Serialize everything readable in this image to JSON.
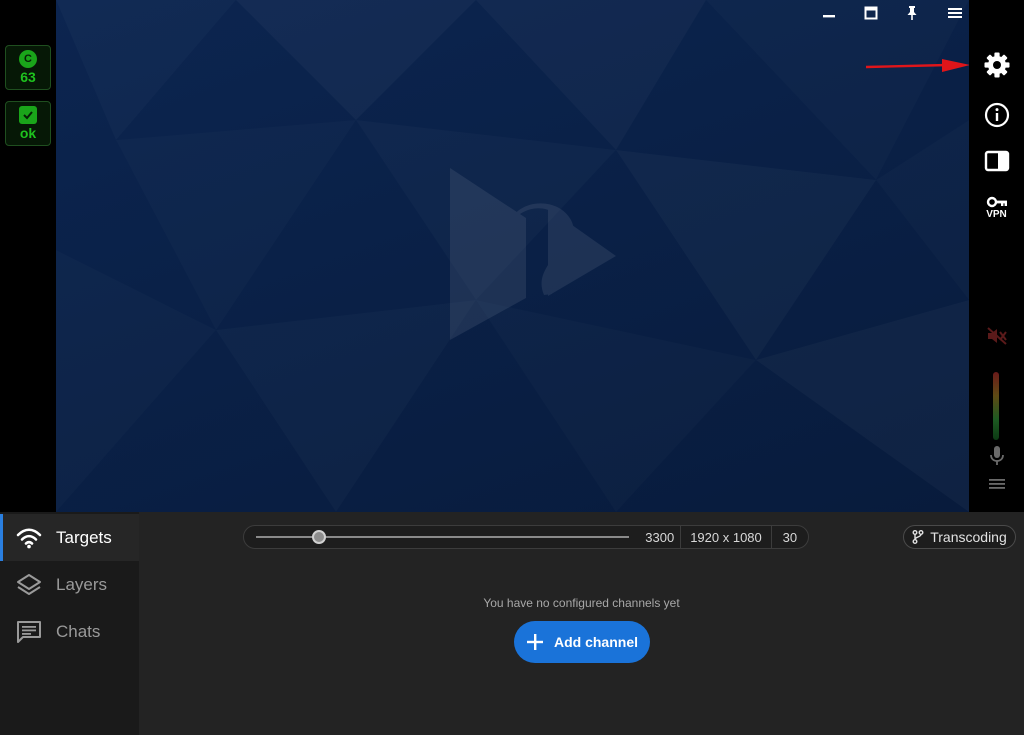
{
  "left_status": [
    {
      "icon": "c-badge-icon",
      "glyph": "C",
      "value": "63"
    },
    {
      "icon": "shield-check-icon",
      "glyph": "",
      "value": "ok"
    }
  ],
  "window_controls": [
    "minimize-icon",
    "maximize-icon",
    "pin-icon",
    "menu-icon",
    "close-icon"
  ],
  "right_toolbar": {
    "settings": "gear-icon",
    "info": "info-icon",
    "layout": "sidebar-toggle-icon",
    "vpn_label": "VPN",
    "mute": "speaker-muted-icon",
    "mic": "microphone-icon",
    "more": "menu-icon"
  },
  "nav": {
    "items": [
      {
        "label": "Targets",
        "icon": "wifi-icon",
        "active": true
      },
      {
        "label": "Layers",
        "icon": "layers-icon",
        "active": false
      },
      {
        "label": "Chats",
        "icon": "chat-icon",
        "active": false
      }
    ]
  },
  "controls": {
    "bitrate_value": "3300",
    "bitrate_fraction": 0.17,
    "resolution": "1920 x 1080",
    "fps": "30",
    "transcoding_label": "Transcoding"
  },
  "channels": {
    "empty_message": "You have no configured channels yet",
    "add_label": "Add channel"
  },
  "colors": {
    "accent": "#1a73d9",
    "status_green": "#1ec21e",
    "annotation_red": "#e0151a"
  }
}
